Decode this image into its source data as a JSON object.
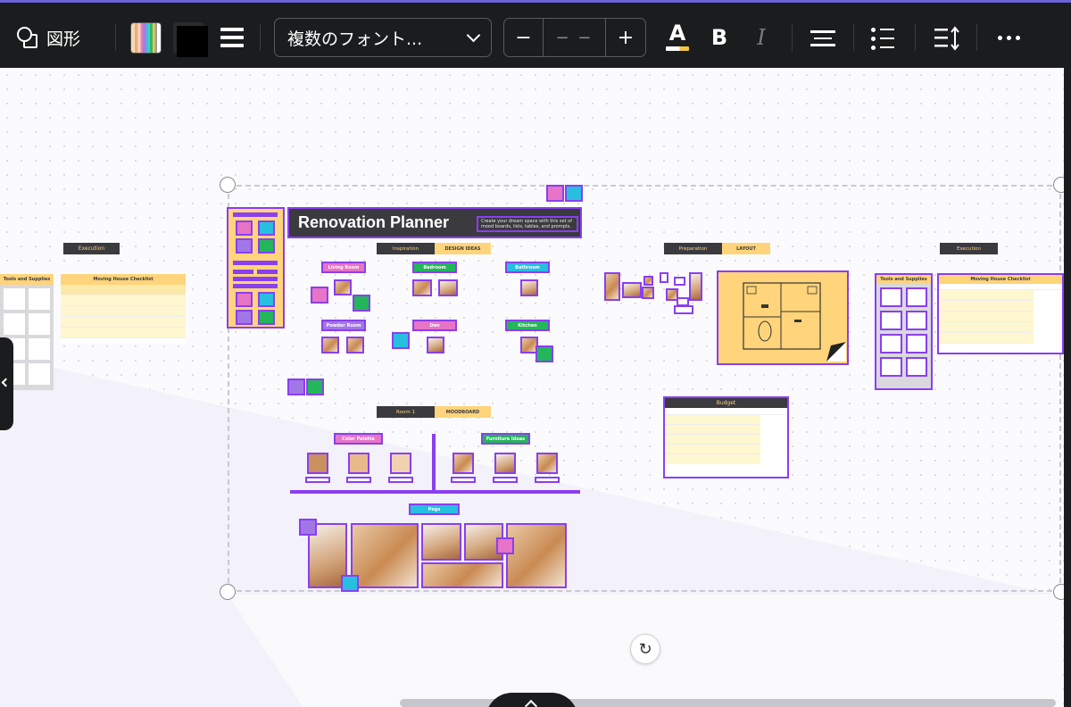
{
  "toolbar": {
    "shape_label": "図形",
    "font_name": "複数のフォント...",
    "size_minus": "−",
    "size_value": "− −",
    "size_plus": "+",
    "text_color_glyph": "A",
    "bold_glyph": "B",
    "italic_glyph": "I"
  },
  "board": {
    "title": "Renovation Planner",
    "subtitle": "Create your dream space with this set of mood boards, lists, tables, and prompts.",
    "inspiration_header": "Inspiration",
    "inspiration_tag": "DESIGN IDEAS",
    "rooms": [
      {
        "label": "Living Room",
        "color": "#e774c6"
      },
      {
        "label": "Bedroom",
        "color": "#23b65a"
      },
      {
        "label": "Bathroom",
        "color": "#27bfe0"
      },
      {
        "label": "Powder Room",
        "color": "#a276e6"
      },
      {
        "label": "Den",
        "color": "#e774c6"
      },
      {
        "label": "Kitchen",
        "color": "#23b65a"
      }
    ],
    "room1_header": "Room 1",
    "room1_tag": "MOODBOARD",
    "color_palette": "Color Palette",
    "furniture_ideas": "Furniture Ideas",
    "pegs": "Pegs",
    "preparation_header": "Preparation",
    "preparation_tag": "LAYOUT",
    "execution_header": "Execution",
    "tools_header": "Tools and Supplies",
    "checklist_header": "Moving House Checklist",
    "budget_header": "Budget",
    "left_execution": "Execution",
    "left_tools": "Tools and Supplies",
    "left_checklist": "Moving House Checklist"
  },
  "colors": {
    "purple": "#8a3ff0",
    "yellow": "#ffd47a",
    "dark": "#3a3a3f",
    "toolbar_bg": "#1b1c1e"
  }
}
